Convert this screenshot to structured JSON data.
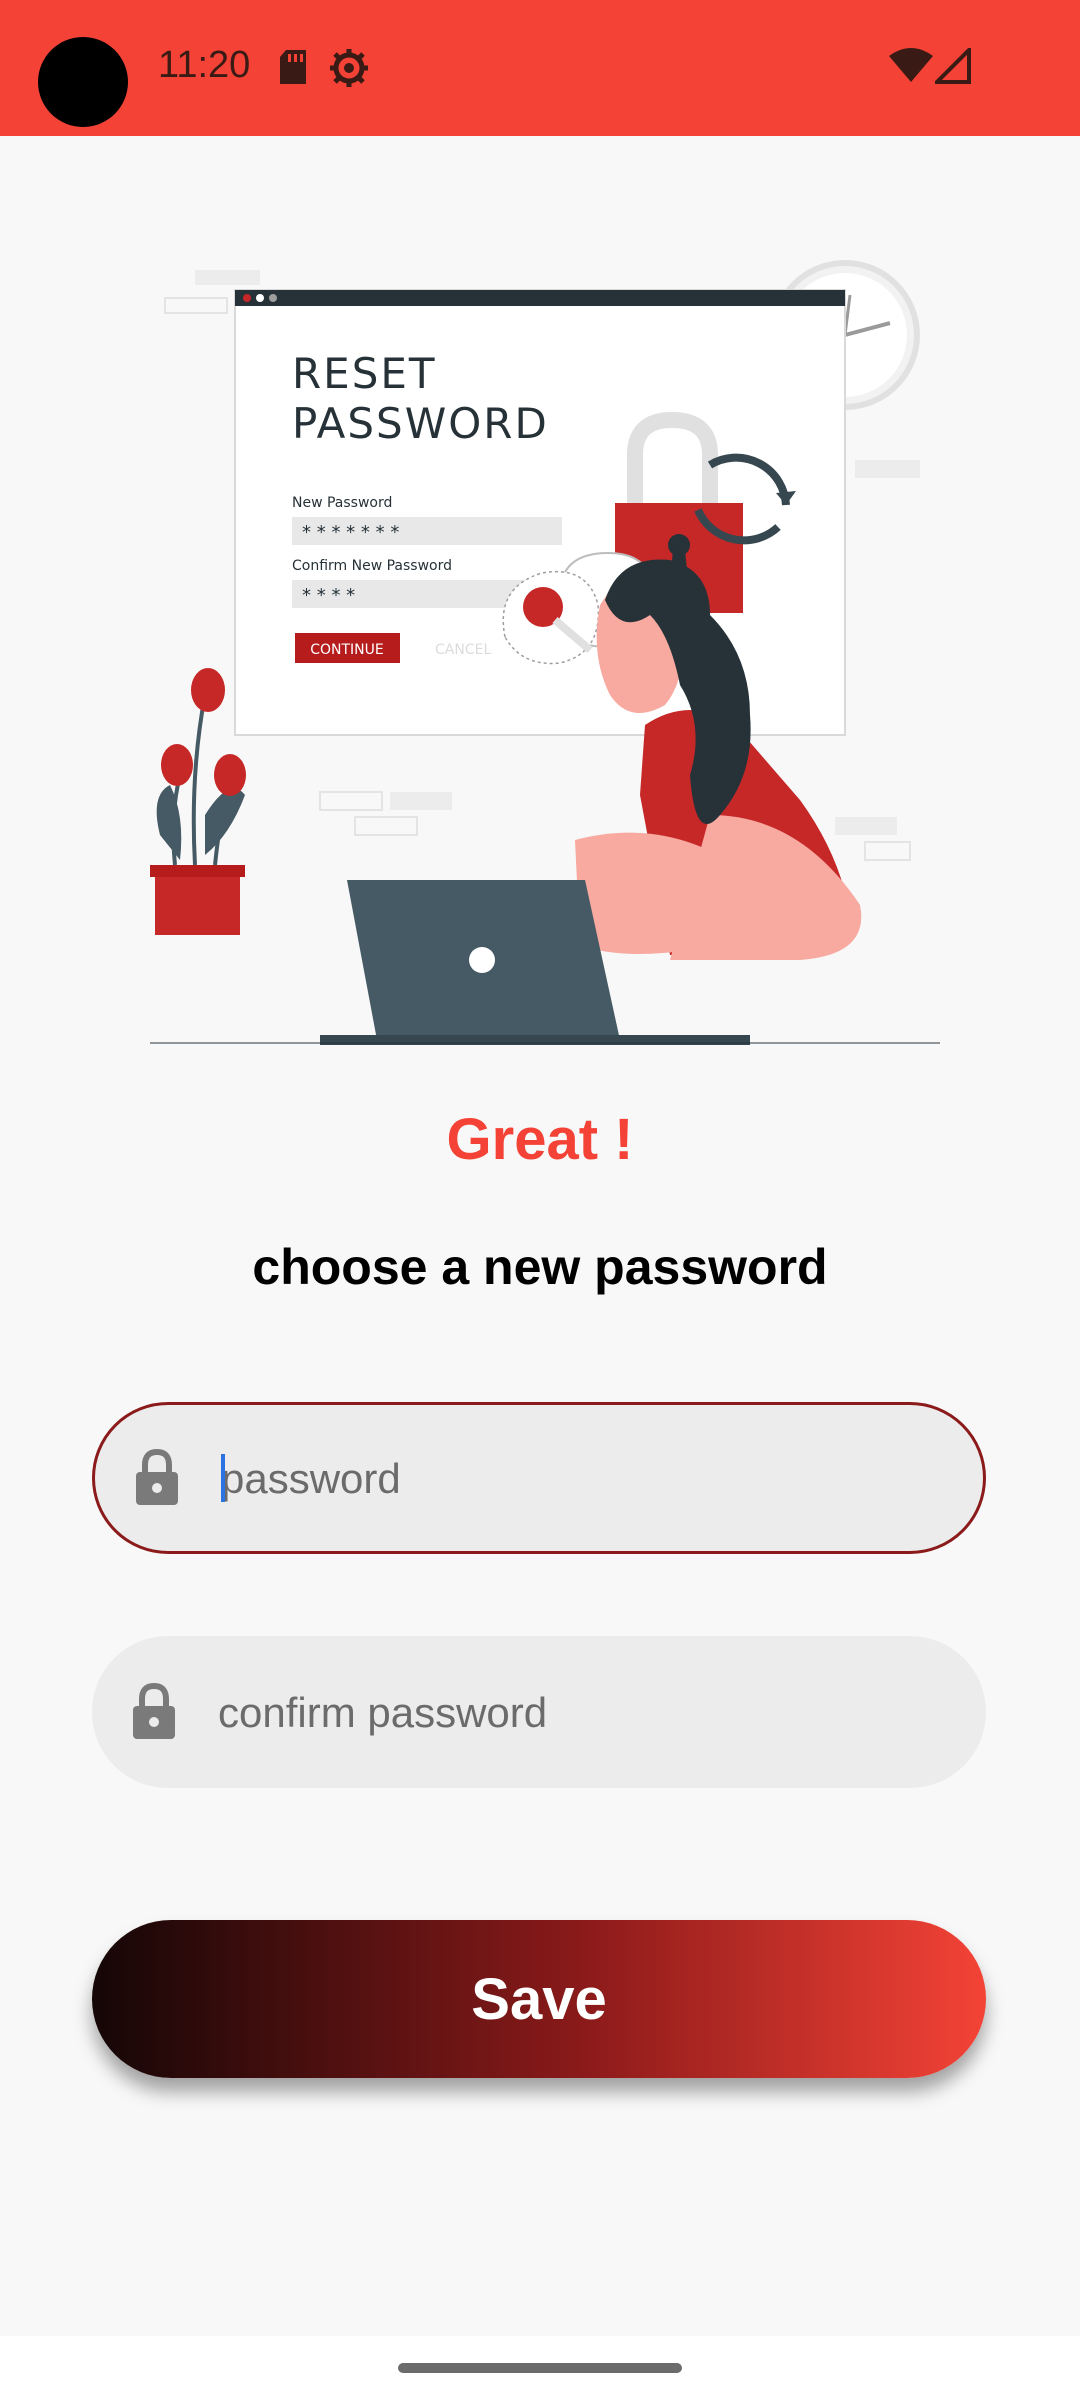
{
  "status_bar": {
    "time": "11:20",
    "icons": [
      "sd-card-icon",
      "settings-icon",
      "wifi-icon",
      "signal-icon"
    ]
  },
  "illustration": {
    "heading_line1": "RESET",
    "heading_line2": "PASSWORD",
    "new_password_label": "New Password",
    "new_password_mask": "* * * * * * *",
    "confirm_label": "Confirm New Password",
    "confirm_mask": "* * * *",
    "continue_label": "CONTINUE",
    "cancel_label": "CANCEL"
  },
  "header": {
    "title": "Great !",
    "subtitle": "choose a new password"
  },
  "form": {
    "password_placeholder": "password",
    "confirm_placeholder": "confirm password",
    "save_label": "Save"
  },
  "colors": {
    "accent": "#f44336",
    "dark_red": "#8b1a1a",
    "field_bg": "#ececec"
  }
}
